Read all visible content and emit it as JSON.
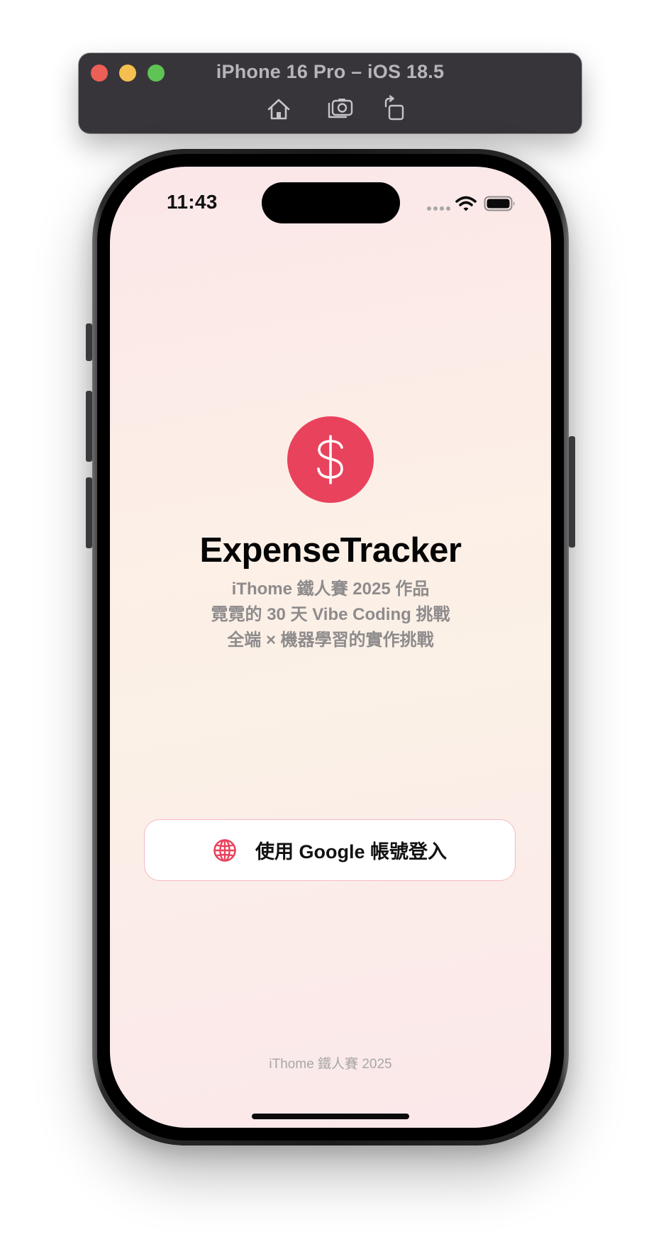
{
  "simulator": {
    "title": "iPhone 16 Pro – iOS 18.5",
    "toolbar": [
      "home-icon",
      "screenshot-icon",
      "rotate-icon"
    ]
  },
  "status_bar": {
    "time": "11:43"
  },
  "app": {
    "title": "ExpenseTracker",
    "logo_icon": "dollar-sign-icon",
    "subtitles": [
      "iThome 鐵人賽 2025 作品",
      "霓霓的 30 天 Vibe Coding 挑戰",
      "全端 × 機器學習的實作挑戰"
    ],
    "login_button": {
      "icon": "globe-icon",
      "label": "使用 Google 帳號登入"
    },
    "footer": "iThome 鐵人賽 2025"
  },
  "colors": {
    "accent": "#e9425d",
    "toolbar_bg": "#37353a",
    "button_border": "#f4b8c3",
    "subtitle_text": "#8e8b8c"
  }
}
